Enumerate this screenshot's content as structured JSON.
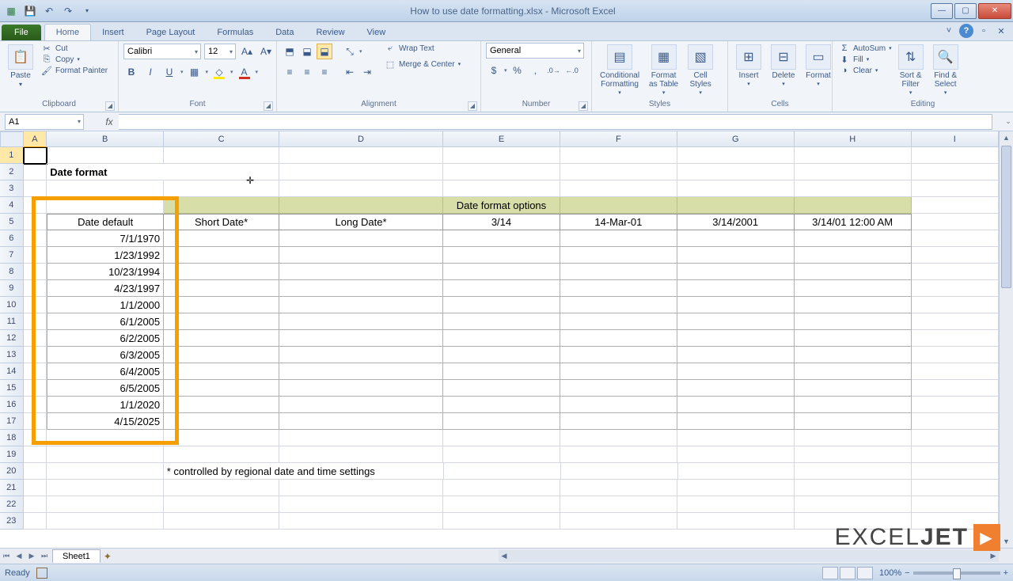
{
  "titlebar": {
    "title": "How to use date formatting.xlsx - Microsoft Excel"
  },
  "tabs": {
    "file": "File",
    "items": [
      "Home",
      "Insert",
      "Page Layout",
      "Formulas",
      "Data",
      "Review",
      "View"
    ],
    "active": "Home"
  },
  "ribbon": {
    "clipboard": {
      "paste": "Paste",
      "cut": "Cut",
      "copy": "Copy",
      "format_painter": "Format Painter",
      "label": "Clipboard"
    },
    "font": {
      "name": "Calibri",
      "size": "12",
      "label": "Font"
    },
    "alignment": {
      "wrap": "Wrap Text",
      "merge": "Merge & Center",
      "label": "Alignment"
    },
    "number": {
      "format": "General",
      "label": "Number"
    },
    "styles": {
      "cond": "Conditional\nFormatting",
      "table": "Format\nas Table",
      "cell": "Cell\nStyles",
      "label": "Styles"
    },
    "cells": {
      "insert": "Insert",
      "delete": "Delete",
      "format": "Format",
      "label": "Cells"
    },
    "editing": {
      "autosum": "AutoSum",
      "fill": "Fill",
      "clear": "Clear",
      "sort": "Sort &\nFilter",
      "find": "Find &\nSelect",
      "label": "Editing"
    }
  },
  "namebox": "A1",
  "formula": "",
  "columns": [
    "A",
    "B",
    "C",
    "D",
    "E",
    "F",
    "G",
    "H",
    "I"
  ],
  "row_count": 23,
  "content": {
    "title": "Date format",
    "banner": "Date format options",
    "headers": [
      "Date default",
      "Short Date*",
      "Long Date*",
      "3/14",
      "14-Mar-01",
      "3/14/2001",
      "3/14/01 12:00 AM"
    ],
    "dates": [
      "7/1/1970",
      "1/23/1992",
      "10/23/1994",
      "4/23/1997",
      "1/1/2000",
      "6/1/2005",
      "6/2/2005",
      "6/3/2005",
      "6/4/2005",
      "6/5/2005",
      "1/1/2020",
      "4/15/2025"
    ],
    "footnote": "* controlled by regional date and time settings"
  },
  "sheet": {
    "name": "Sheet1"
  },
  "statusbar": {
    "ready": "Ready",
    "zoom": "100%"
  },
  "watermark": {
    "a": "EXCEL",
    "b": "JET"
  }
}
